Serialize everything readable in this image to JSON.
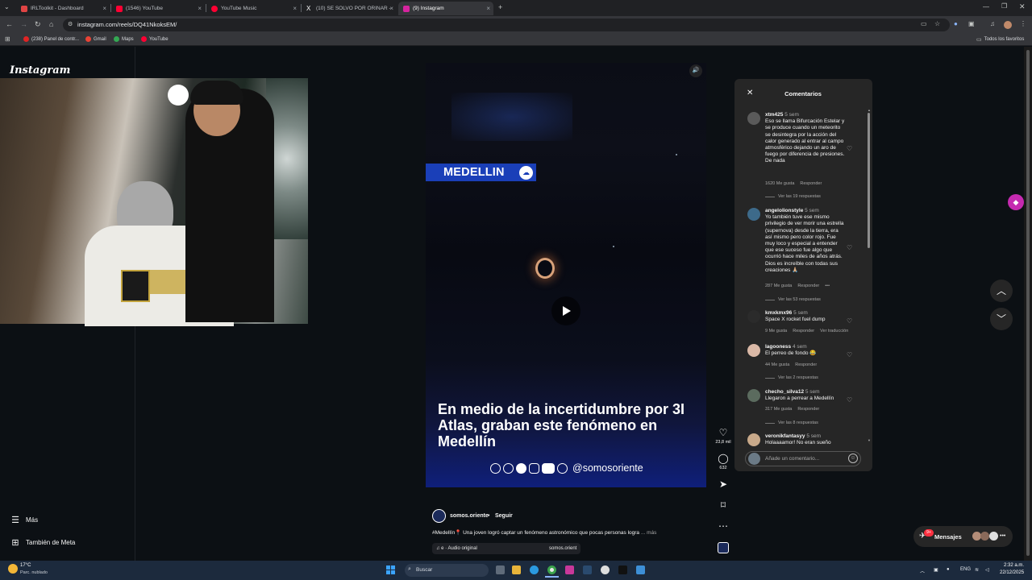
{
  "browser": {
    "tabs": [
      {
        "title": "IRLToolkit - Dashboard",
        "color": "#e04444"
      },
      {
        "title": "(1546) YouTube",
        "color": "#ff0033"
      },
      {
        "title": "YouTube Music",
        "color": "#ff0033"
      },
      {
        "title": "(10) SE SOLVO POR ORINAR -",
        "color": "#ffffff"
      },
      {
        "title": "(9) Instagram",
        "color": "#d6249f"
      }
    ],
    "new_tab_icon": "+",
    "url": "instagram.com/reels/DQ41NkoksEM/",
    "bookmarks": [
      {
        "label": "(238) Panel de contr...",
        "color": "#e02424"
      },
      {
        "label": "Gmail",
        "color": "#ea4335"
      },
      {
        "label": "Maps",
        "color": "#34a853"
      },
      {
        "label": "YouTube",
        "color": "#ff0033"
      }
    ],
    "all_favorites": "Todos los favoritos"
  },
  "instagram": {
    "logo": "Instagram",
    "sidebar": {
      "more": "Más",
      "also_meta": "También de Meta"
    }
  },
  "reel": {
    "badge": "MEDELLIN",
    "headline": "En medio de la incertidumbre por 3I Atlas, graban este fenómeno en Medellín",
    "social_handle": "@somosoriente",
    "likes": "23,8 mil",
    "comments_count": "632",
    "author": "somos.oriente",
    "separator": "•",
    "follow": "Seguir",
    "caption": "#Medellín📍 Una joven logró captar un fenómeno astronómico que pocas personas logra",
    "caption_more": "... más",
    "audio": "♫ e · Audio original",
    "audio_user": "somos.orient"
  },
  "comments_panel": {
    "title": "Comentarios",
    "input_placeholder": "Añade un comentario...",
    "comments": [
      {
        "user": "xtm425",
        "time": "5 sem",
        "text": "Eso se llama Bifurcación Estelar y se produce cuando un meteorito se desintegra por la acción del calor generado al entrar al campo atmosférico dejando un aro de fuego por diferencia de presiones. De nada",
        "likes": "1620 Me gusta",
        "reply": "Responder",
        "replies": "Ver las 19 respuestas",
        "avatar": "#5a5a5a"
      },
      {
        "user": "angelolionstyle",
        "time": "5 sem",
        "text": "Yo también tuve ese mismo privilegio de ver morir una estrella (supernova) desde la tierra, era así mismo pero color rojo. Fue muy loco y especial a entender que ese suceso fue algo que ocurrió hace miles de años atrás. Dios es increíble con todas sus creaciones 🙏🏼",
        "likes": "287 Me gusta",
        "reply": "Responder",
        "extra": "•••",
        "replies": "Ver las 53 respuestas",
        "avatar": "#3d6a8a"
      },
      {
        "user": "kmxkmx96",
        "time": "5 sem",
        "text": "Space X rocket fuel dump",
        "likes": "9 Me gusta",
        "reply": "Responder",
        "translate": "Ver traducción",
        "avatar": "#2b2b2b"
      },
      {
        "user": "lagooness",
        "time": "4 sem",
        "text": "El perreo de fondo 😂",
        "likes": "44 Me gusta",
        "reply": "Responder",
        "replies": "Ver las 2 respuestas",
        "avatar": "#d9b8a6"
      },
      {
        "user": "checho_silva12",
        "time": "5 sem",
        "text": "Llegaron a perrear a Medellín",
        "likes": "317 Me gusta",
        "reply": "Responder",
        "replies": "Ver las 8 respuestas",
        "avatar": "#5b6b5e"
      },
      {
        "user": "veronikfantasyy",
        "time": "5 sem",
        "text": "Holaaaamor! No eran sueño",
        "avatar": "#c8a98a"
      }
    ]
  },
  "messages": {
    "label": "Mensajes",
    "badge": "9+"
  },
  "taskbar": {
    "temp": "17°C",
    "weather": "Parc. nublado",
    "search": "Buscar",
    "lang": "ENG",
    "time": "2:32 a.m.",
    "date": "22/12/2025"
  }
}
